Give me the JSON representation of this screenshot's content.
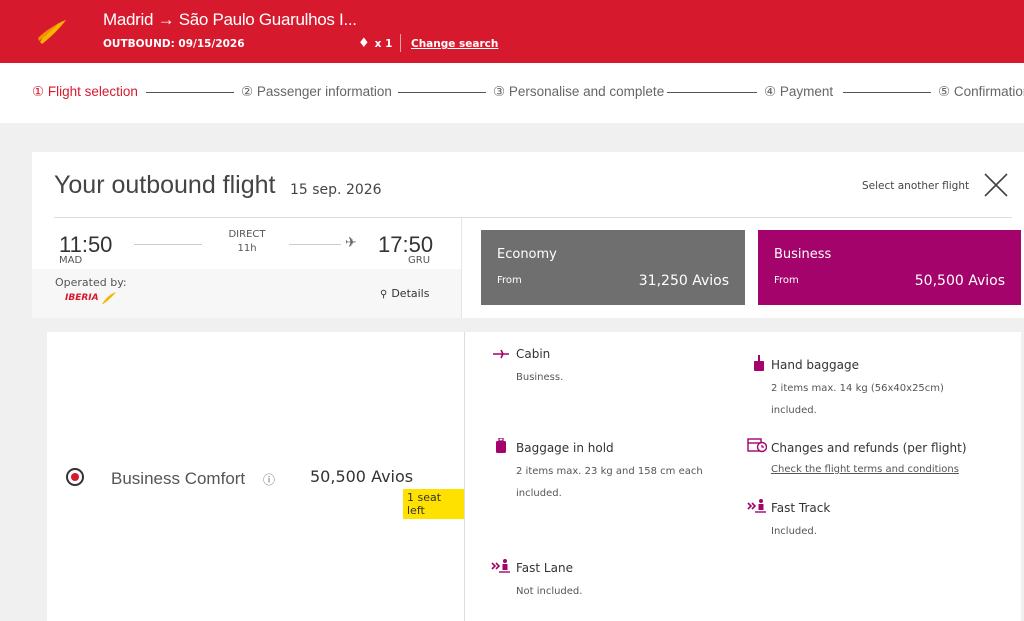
{
  "header": {
    "route": "Madrid → São Paulo Guarulhos I...",
    "outbound": "OUTBOUND: 09/15/2026",
    "pax_count": "x 1",
    "change_search": "Change search"
  },
  "steps": [
    {
      "label": "① Flight selection"
    },
    {
      "label": "② Passenger information"
    },
    {
      "label": "③ Personalise and complete"
    },
    {
      "label": "④ Payment"
    },
    {
      "label": "⑤ Confirmation"
    }
  ],
  "flight": {
    "title": "Your outbound flight",
    "date": "15 sep. 2026",
    "select_other": "Select another flight",
    "dep_time": "11:50",
    "dep_code": "MAD",
    "stops": "DIRECT",
    "duration": "11h",
    "arr_time": "17:50",
    "arr_code": "GRU",
    "operated_by": "Operated by:",
    "operator": "IBERIA",
    "details": "Details"
  },
  "fares": {
    "economy": {
      "name": "Economy",
      "from": "From",
      "price": "31,250 Avios"
    },
    "business": {
      "name": "Business",
      "from": "From",
      "price": "50,500 Avios"
    }
  },
  "selected_fare": {
    "name": "Business Comfort",
    "price": "50,500 Avios",
    "badge": "1 seat left"
  },
  "features": {
    "cabin": {
      "title": "Cabin",
      "desc": "Business."
    },
    "hand_baggage": {
      "title": "Hand baggage",
      "desc1": "2 items max. 14 kg (56x40x25cm)",
      "desc2": "included."
    },
    "hold_baggage": {
      "title": "Baggage in hold",
      "desc1": "2 items max. 23 kg and 158 cm each",
      "desc2": "included."
    },
    "changes": {
      "title": "Changes and refunds (per flight)",
      "link": "Check the flight terms and conditions"
    },
    "fast_track": {
      "title": "Fast Track",
      "desc": "Included."
    },
    "fast_lane": {
      "title": "Fast Lane",
      "desc": "Not included."
    }
  },
  "colors": {
    "brand_red": "#d7192d",
    "business_purple": "#a3036b",
    "economy_gray": "#6f6f6f",
    "badge_yellow": "#ffe100"
  }
}
